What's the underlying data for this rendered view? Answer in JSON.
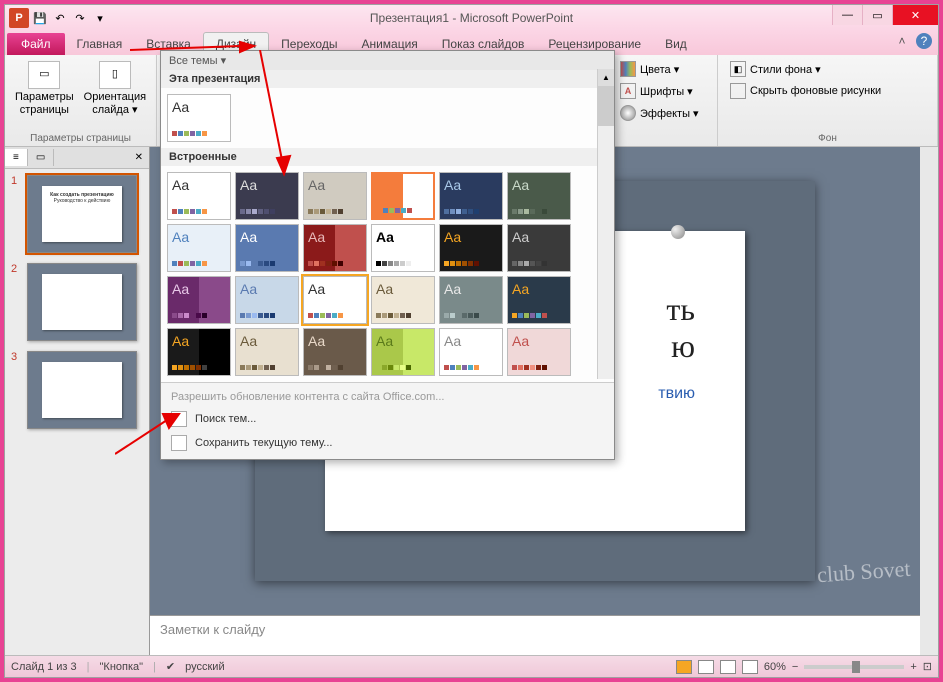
{
  "title": "Презентация1 - Microsoft PowerPoint",
  "qat": {
    "app_letter": "P",
    "save": "💾",
    "undo": "↶",
    "redo": "↷"
  },
  "win": {
    "min": "—",
    "max": "▭",
    "close": "✕"
  },
  "tabs": {
    "file": "Файл",
    "home": "Главная",
    "insert": "Вставка",
    "design": "Дизайн",
    "transitions": "Переходы",
    "animation": "Анимация",
    "slideshow": "Показ слайдов",
    "review": "Рецензирование",
    "view": "Вид"
  },
  "ribbon_help": {
    "minimize": "˄",
    "help": "?"
  },
  "groups": {
    "page_setup": {
      "label": "Параметры страницы",
      "page_params": "Параметры\nстраницы",
      "orientation": "Ориентация\nслайда ▾"
    },
    "themes_right": {
      "colors": "Цвета ▾",
      "fonts": "Шрифты ▾",
      "effects": "Эффекты ▾"
    },
    "background": {
      "label": "Фон",
      "styles": "Стили фона ▾",
      "hide": "Скрыть фоновые рисунки"
    }
  },
  "gallery": {
    "header": "Все темы ▾",
    "this_presentation": "Эта презентация",
    "builtin": "Встроенные",
    "office_update": "Разрешить обновление контента с сайта Office.com...",
    "browse": "Поиск тем...",
    "save_theme": "Сохранить текущую тему...",
    "themes": [
      {
        "bg": "#ffffff",
        "fg": "#333",
        "dots": [
          "#c0504d",
          "#4f81bd",
          "#9bbb59",
          "#8064a2",
          "#4bacc6",
          "#f79646"
        ]
      },
      {
        "bg": "#3b3b4f",
        "fg": "#ddd",
        "dots": [
          "#6a6a8a",
          "#8a8aaa",
          "#aaaacc",
          "#5f5f7f",
          "#4f4f6f",
          "#3f3f5f"
        ]
      },
      {
        "bg": "#d0cbc0",
        "fg": "#666",
        "dots": [
          "#8a7a5a",
          "#aa9a7a",
          "#6a5a3a",
          "#c0b090",
          "#706050",
          "#504030"
        ]
      },
      {
        "bg": "#f47c3c",
        "fg": "#f47c3c",
        "bg2": "#fff",
        "dots": [
          "#f47c3c",
          "#4f81bd",
          "#9bbb59",
          "#8064a2",
          "#4bacc6",
          "#c0504d"
        ],
        "border": true
      },
      {
        "bg": "#2a3b5f",
        "fg": "#a8c8e8",
        "dots": [
          "#4f6f9f",
          "#6f8fbf",
          "#8fafdf",
          "#3f5f8f",
          "#2f4f7f",
          "#1f3f6f"
        ]
      },
      {
        "bg": "#4a5a4a",
        "fg": "#c8d8c8",
        "dots": [
          "#6a7a6a",
          "#8a9a8a",
          "#aabaa0",
          "#5a6a5a",
          "#4a5a4a",
          "#3a4a3a"
        ]
      },
      {
        "bg": "#e8f0f8",
        "fg": "#4f81bd",
        "dots": [
          "#4f81bd",
          "#c0504d",
          "#9bbb59",
          "#8064a2",
          "#4bacc6",
          "#f79646"
        ]
      },
      {
        "bg": "#5a7ab0",
        "fg": "#fff",
        "dots": [
          "#7a9ad0",
          "#9abaf0",
          "#5a7ab0",
          "#3a5a90",
          "#2a4a80",
          "#1a3a70"
        ]
      },
      {
        "bg": "#8b1a1a",
        "fg": "#e8b8b8",
        "bg2": "#c0504d",
        "dots": [
          "#c0504d",
          "#e07060",
          "#a03020",
          "#802010",
          "#601000",
          "#400000"
        ]
      },
      {
        "bg": "#ffffff",
        "fg": "#000",
        "bold": true,
        "dots": [
          "#000",
          "#444",
          "#888",
          "#aaa",
          "#ccc",
          "#eee"
        ]
      },
      {
        "bg": "#1a1a1a",
        "fg": "#f5a623",
        "dots": [
          "#f5a623",
          "#e09010",
          "#c07000",
          "#a05000",
          "#803000",
          "#601000"
        ]
      },
      {
        "bg": "#3a3a3a",
        "fg": "#ccc",
        "dots": [
          "#666",
          "#888",
          "#aaa",
          "#555",
          "#444",
          "#333"
        ]
      },
      {
        "bg": "#6a2a6a",
        "fg": "#e8c8e8",
        "bg2": "#8a4a8a",
        "dots": [
          "#8a4a8a",
          "#aa6aaa",
          "#ca8aca",
          "#6a2a6a",
          "#4a0a4a",
          "#2a002a"
        ]
      },
      {
        "bg": "#c8d8e8",
        "fg": "#5a7ab0",
        "dots": [
          "#5a7ab0",
          "#7a9ad0",
          "#9abaf0",
          "#3a5a90",
          "#2a4a80",
          "#1a3a70"
        ]
      },
      {
        "bg": "#ffffff",
        "fg": "#333",
        "dots": [
          "#c0504d",
          "#4f81bd",
          "#9bbb59",
          "#8064a2",
          "#4bacc6",
          "#f79646"
        ],
        "selected": true
      },
      {
        "bg": "#f0e8d8",
        "fg": "#6a5a3a",
        "frame": true,
        "dots": [
          "#8a7a5a",
          "#aa9a7a",
          "#6a5a3a",
          "#c0b090",
          "#706050",
          "#504030"
        ]
      },
      {
        "bg": "#7a8a8a",
        "fg": "#e8e8e8",
        "dots": [
          "#9aaaaa",
          "#bacccc",
          "#7a8a8a",
          "#5a6a6a",
          "#4a5a5a",
          "#3a4a4a"
        ]
      },
      {
        "bg": "#2a3a4a",
        "fg": "#f5a623",
        "dots": [
          "#f5a623",
          "#4f81bd",
          "#9bbb59",
          "#8064a2",
          "#4bacc6",
          "#c0504d"
        ]
      },
      {
        "bg": "#1a1a1a",
        "fg": "#f5a623",
        "bg2": "#000",
        "dots": [
          "#f5a623",
          "#e09010",
          "#c07000",
          "#a05000",
          "#803000",
          "#404040"
        ]
      },
      {
        "bg": "#e8e0d0",
        "fg": "#6a5a3a",
        "dots": [
          "#8a7a5a",
          "#aa9a7a",
          "#6a5a3a",
          "#c0b090",
          "#706050",
          "#504030"
        ]
      },
      {
        "bg": "#6a5a4a",
        "fg": "#e8d8c8",
        "dots": [
          "#8a7a6a",
          "#aa9a8a",
          "#6a5a4a",
          "#c0b0a0",
          "#706050",
          "#504030"
        ]
      },
      {
        "bg": "#aac84a",
        "fg": "#5a7a1a",
        "bg2": "#c8e868",
        "dots": [
          "#aac84a",
          "#8aa82a",
          "#6a880a",
          "#c8e868",
          "#e8ff88",
          "#4a6800"
        ]
      },
      {
        "bg": "#ffffff",
        "fg": "#888",
        "dots": [
          "#c0504d",
          "#4f81bd",
          "#9bbb59",
          "#8064a2",
          "#4bacc6",
          "#f79646"
        ]
      },
      {
        "bg": "#f0d8d8",
        "fg": "#c0504d",
        "dots": [
          "#c0504d",
          "#e07060",
          "#a03020",
          "#f09080",
          "#802010",
          "#601000"
        ]
      }
    ]
  },
  "slides": {
    "count": 3,
    "items": [
      {
        "title": "Как создать презентацию",
        "sub": "Руководство к действию"
      },
      {
        "title": "",
        "sub": ""
      },
      {
        "title": "",
        "sub": ""
      }
    ]
  },
  "canvas": {
    "title_visible": "ть\nю",
    "subtitle_visible": "твию"
  },
  "notes": {
    "placeholder": "Заметки к слайду"
  },
  "status": {
    "slide": "Слайд 1 из 3",
    "theme": "\"Кнопка\"",
    "lang": "русский",
    "zoom": "60%",
    "fit": "⊡"
  },
  "panel": {
    "tab1": "≡",
    "tab2": "▭",
    "close": "✕"
  },
  "watermark": "club Sovet"
}
